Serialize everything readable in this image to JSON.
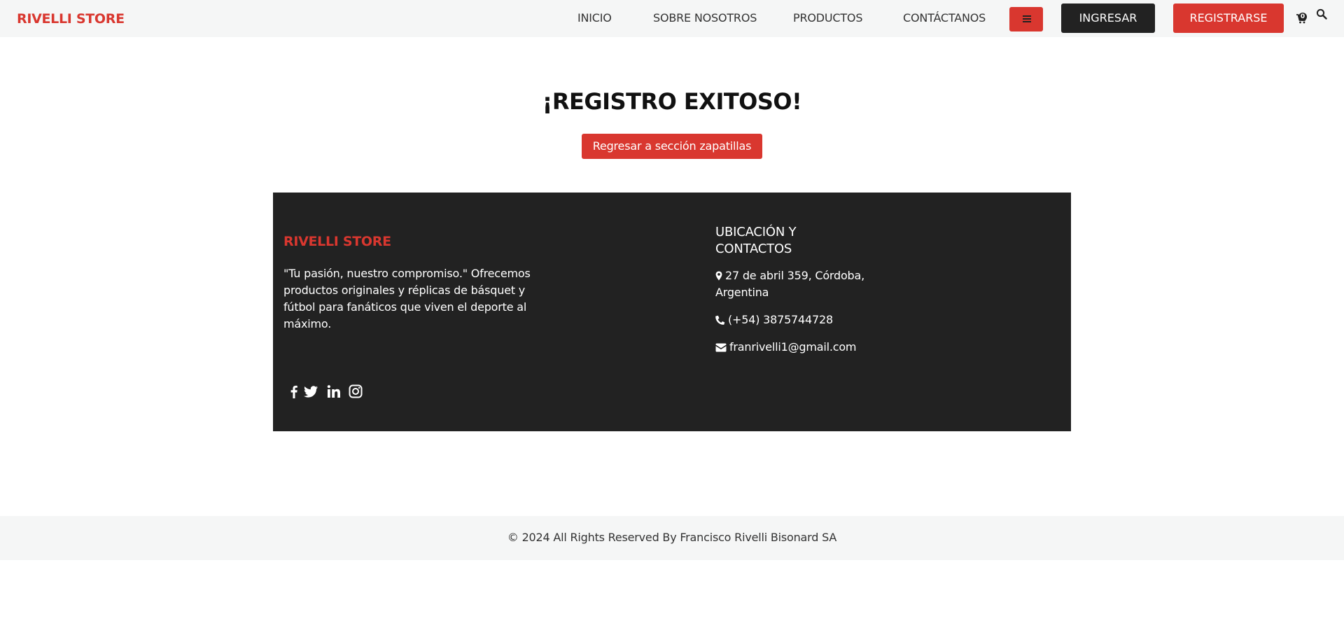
{
  "header": {
    "brand": "RIVELLI STORE",
    "nav": [
      "INICIO",
      "SOBRE NOSOTROS",
      "PRODUCTOS",
      "CONTÁCTANOS"
    ],
    "login_label": "INGRESAR",
    "register_label": "REGISTRARSE",
    "cart_count": "0",
    "icons": [
      "menu-icon",
      "cart-icon",
      "search-icon"
    ]
  },
  "main": {
    "title": "¡REGISTRO EXITOSO!",
    "back_button": "Regresar a sección zapatillas"
  },
  "footer": {
    "brand": "RIVELLI STORE",
    "description": "\"Tu pasión, nuestro compromiso.\" Ofrecemos productos originales y réplicas de básquet y fútbol para fanáticos que viven el deporte al máximo.",
    "social_icons": [
      "facebook-icon",
      "twitter-icon",
      "linkedin-icon",
      "instagram-icon"
    ],
    "contact_title": "UBICACIÓN Y CONTACTOS",
    "address": "27 de abril 359, Córdoba, Argentina",
    "phone": "(+54) 3875744728",
    "email": "franrivelli1@gmail.com"
  },
  "bottom": {
    "copyright": "© 2024 All Rights Reserved By Francisco Rivelli Bisonard SA"
  },
  "colors": {
    "accent": "#d9372f",
    "dark": "#222222",
    "light_bg": "#f5f6f6"
  }
}
